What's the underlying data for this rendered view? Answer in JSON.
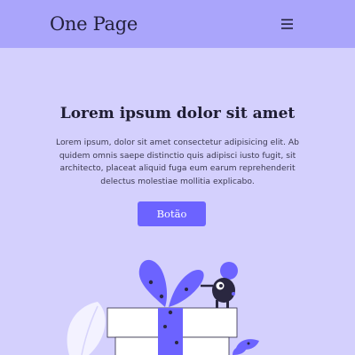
{
  "navbar": {
    "brand": "One Page",
    "menu_icon": "hamburger-menu-icon"
  },
  "hero": {
    "title": "Lorem ipsum dolor sit amet",
    "description": "Lorem ipsum, dolor sit amet consectetur adipisicing elit. Ab quidem omnis saepe distinctio quis adipisci iusto fugit, sit architecto, placeat aliquid fuga eum earum reprehenderit delectus molestiae mollitia explicabo.",
    "button_label": "Botão"
  },
  "colors": {
    "page_background": "#d4d0fd",
    "navbar_background": "#aaa5fb",
    "accent": "#6c63ff",
    "dark_text": "#1f1d33"
  },
  "illustration": {
    "name": "gift-box-with-monster-illustration"
  }
}
